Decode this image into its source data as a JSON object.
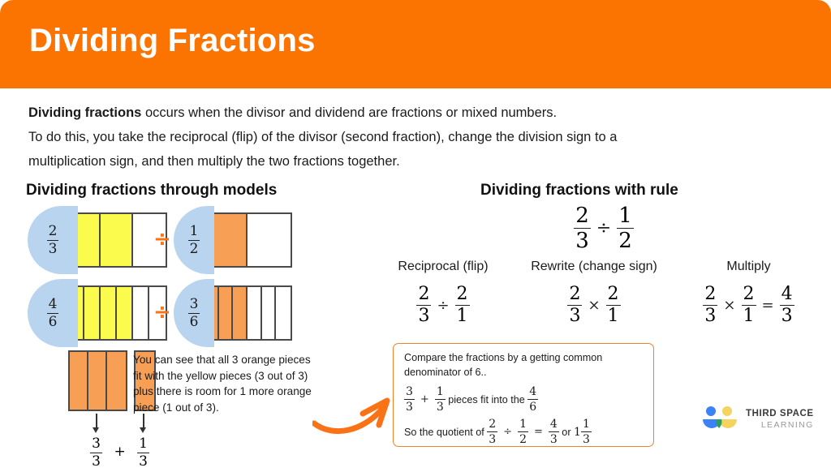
{
  "header": {
    "title": "Dividing Fractions",
    "bg": "#fb7300"
  },
  "intro": {
    "lead": "Dividing fractions",
    "line1_rest": " occurs when the divisor and dividend are fractions or mixed numbers.",
    "line2": "To do this, you take the reciprocal (flip) of the divisor (second fraction), change the division sign to a",
    "line3": "multiplication sign, and then multiply the two fractions together."
  },
  "sections": {
    "models_heading": "Dividing fractions through models",
    "rule_heading": "Dividing fractions with rule"
  },
  "models": {
    "divide_symbol": "÷",
    "rows": [
      {
        "left": {
          "label_num": "2",
          "label_den": "3",
          "total": 3,
          "filled": 2,
          "fill": "yellow"
        },
        "right": {
          "label_num": "1",
          "label_den": "2",
          "total": 2,
          "filled": 1,
          "fill": "orange"
        }
      },
      {
        "left": {
          "label_num": "4",
          "label_den": "6",
          "total": 6,
          "filled": 4,
          "fill": "yellow"
        },
        "right": {
          "label_num": "3",
          "label_den": "6",
          "total": 6,
          "filled": 3,
          "fill": "orange"
        }
      }
    ]
  },
  "bottom_left": {
    "group_a_cells": 3,
    "group_b_cells": 1,
    "arrow_a_num": "3",
    "arrow_a_den": "3",
    "plus": "+",
    "arrow_b_num": "1",
    "arrow_b_den": "3",
    "note": "You can see that all 3 orange pieces fit with the yellow pieces (3 out of 3) plus there is room for 1 more orange piece (1 out of 3)."
  },
  "rule": {
    "main": {
      "a_num": "2",
      "a_den": "3",
      "op": "÷",
      "b_num": "1",
      "b_den": "2"
    },
    "steps": [
      {
        "label": "Reciprocal (flip)",
        "a_num": "2",
        "a_den": "3",
        "op": "÷",
        "b_num": "2",
        "b_den": "1"
      },
      {
        "label": "Rewrite (change sign)",
        "a_num": "2",
        "a_den": "3",
        "op": "×",
        "b_num": "2",
        "b_den": "1"
      },
      {
        "label": "Multiply",
        "a_num": "2",
        "a_den": "3",
        "op": "×",
        "b_num": "2",
        "b_den": "1",
        "eq": "=",
        "r_num": "4",
        "r_den": "3"
      }
    ]
  },
  "callout": {
    "line1": "Compare the fractions by a getting common",
    "line2": "denominator of 6..",
    "row2": {
      "a_num": "3",
      "a_den": "3",
      "plus": "+",
      "b_num": "1",
      "b_den": "3",
      "mid": "pieces fit into the",
      "c_num": "4",
      "c_den": "6"
    },
    "row3": {
      "lead": "So the quotient of",
      "a_num": "2",
      "a_den": "3",
      "op": "÷",
      "b_num": "1",
      "b_den": "2",
      "eq": "=",
      "r_num": "4",
      "r_den": "3",
      "or": "or",
      "whole": "1",
      "m_num": "1",
      "m_den": "3"
    },
    "border_color": "#f2812a"
  },
  "logo": {
    "line1": "THIRD SPACE",
    "line2": "LEARNING",
    "blue": "#3b82f6",
    "yellow": "#f4d35e",
    "green": "#2e9e5b"
  }
}
